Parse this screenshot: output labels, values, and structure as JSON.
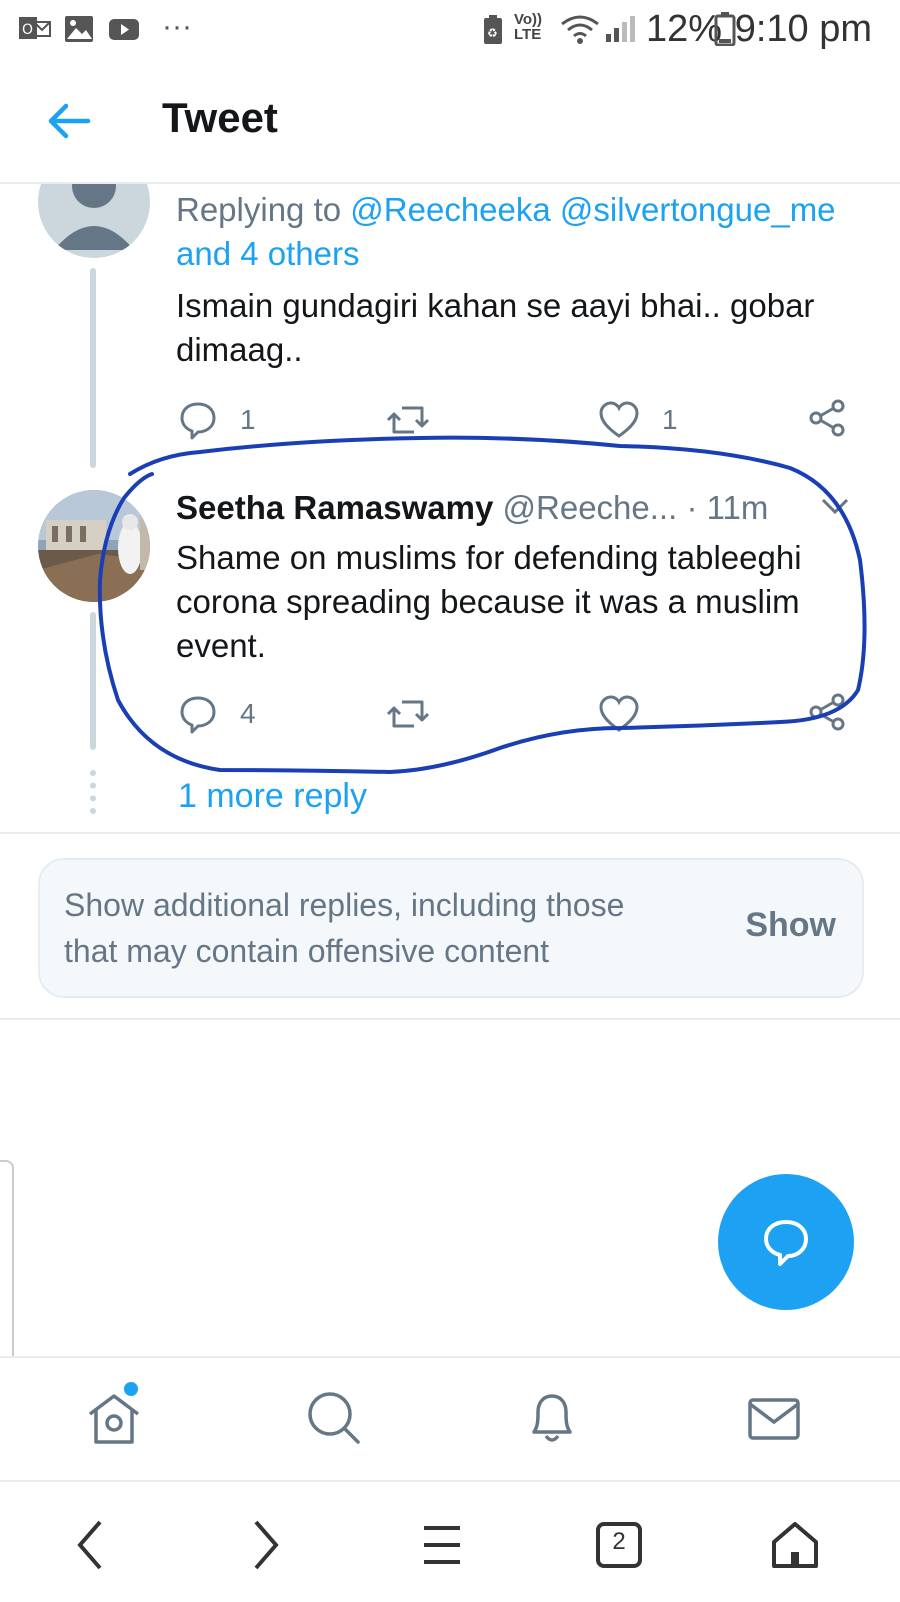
{
  "status_bar": {
    "battery": "12%",
    "time": "9:10 pm",
    "network": "Vo)) LTE",
    "more": "···"
  },
  "header": {
    "title": "Tweet"
  },
  "reply1": {
    "replying_label": "Replying to",
    "replying_handles": "@Reecheeka @silvertongue_me",
    "replying_others": "and 4 others",
    "text": "Ismain gundagiri kahan se aayi bhai.. gobar dimaag..",
    "reply_count": "1",
    "retweet_count": "",
    "like_count": "1"
  },
  "reply2": {
    "name": "Seetha Ramaswamy",
    "handle": "@Reeche...",
    "time": "· 11m",
    "text": "Shame on muslims for defending tableeghi corona spreading because it was a muslim event.",
    "reply_count": "4",
    "retweet_count": "",
    "like_count": ""
  },
  "more_reply": "1 more reply",
  "additional": {
    "text": "Show additional replies, including those that may contain offensive content",
    "button": "Show"
  },
  "tabs": {
    "home": "home-icon",
    "search": "search-icon",
    "notifications": "bell-icon",
    "messages": "mail-icon"
  },
  "browser_nav": {
    "tab_count": "2"
  },
  "colors": {
    "accent": "#1da1f2",
    "annotation": "#1a3fb5",
    "muted": "#657786"
  }
}
